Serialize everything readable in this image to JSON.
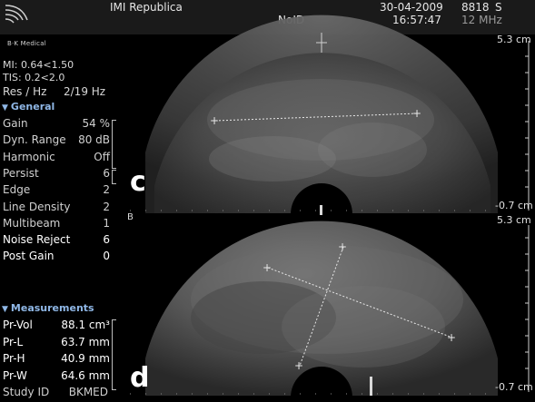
{
  "header": {
    "site": "IMI Republica",
    "patient_id": "NoID",
    "date": "30-04-2009",
    "time": "16:57:47",
    "probe": "8818",
    "probe_mode": "S",
    "frequency": "12 MHz",
    "brand": "B·K Medical"
  },
  "status": {
    "mi": "MI:   0.64<1.50",
    "tis": "TIS:   0.2<2.0",
    "res_label": "Res / Hz",
    "res_value": "2/19 Hz"
  },
  "general": {
    "title": "General",
    "params": [
      {
        "label": "Gain",
        "value": "54 %"
      },
      {
        "label": "Dyn. Range",
        "value": "80 dB"
      },
      {
        "label": "Harmonic",
        "value": "Off"
      },
      {
        "label": "Persist",
        "value": "6"
      },
      {
        "label": "Edge",
        "value": "2"
      },
      {
        "label": "Line Density",
        "value": "2"
      },
      {
        "label": "Multibeam",
        "value": "1"
      },
      {
        "label": "Noise Reject",
        "value": "6"
      },
      {
        "label": "Post Gain",
        "value": "0"
      }
    ]
  },
  "measurements": {
    "title": "Measurements",
    "items": [
      {
        "label": "Pr-Vol",
        "value": "88.1 cm³"
      },
      {
        "label": "Pr-L",
        "value": "63.7 mm"
      },
      {
        "label": "Pr-H",
        "value": "40.9 mm"
      },
      {
        "label": "Pr-W",
        "value": "64.6 mm"
      }
    ],
    "study_label": "Study ID",
    "study_value": "BKMED"
  },
  "images": {
    "top_label": "c",
    "bottom_label": "d",
    "plane_marker": "B",
    "depth_top": "5.3 cm",
    "depth_bottom": "-0.7 cm",
    "depth_top_2": "5.3 cm",
    "depth_bottom_2": "-0.7 cm"
  }
}
